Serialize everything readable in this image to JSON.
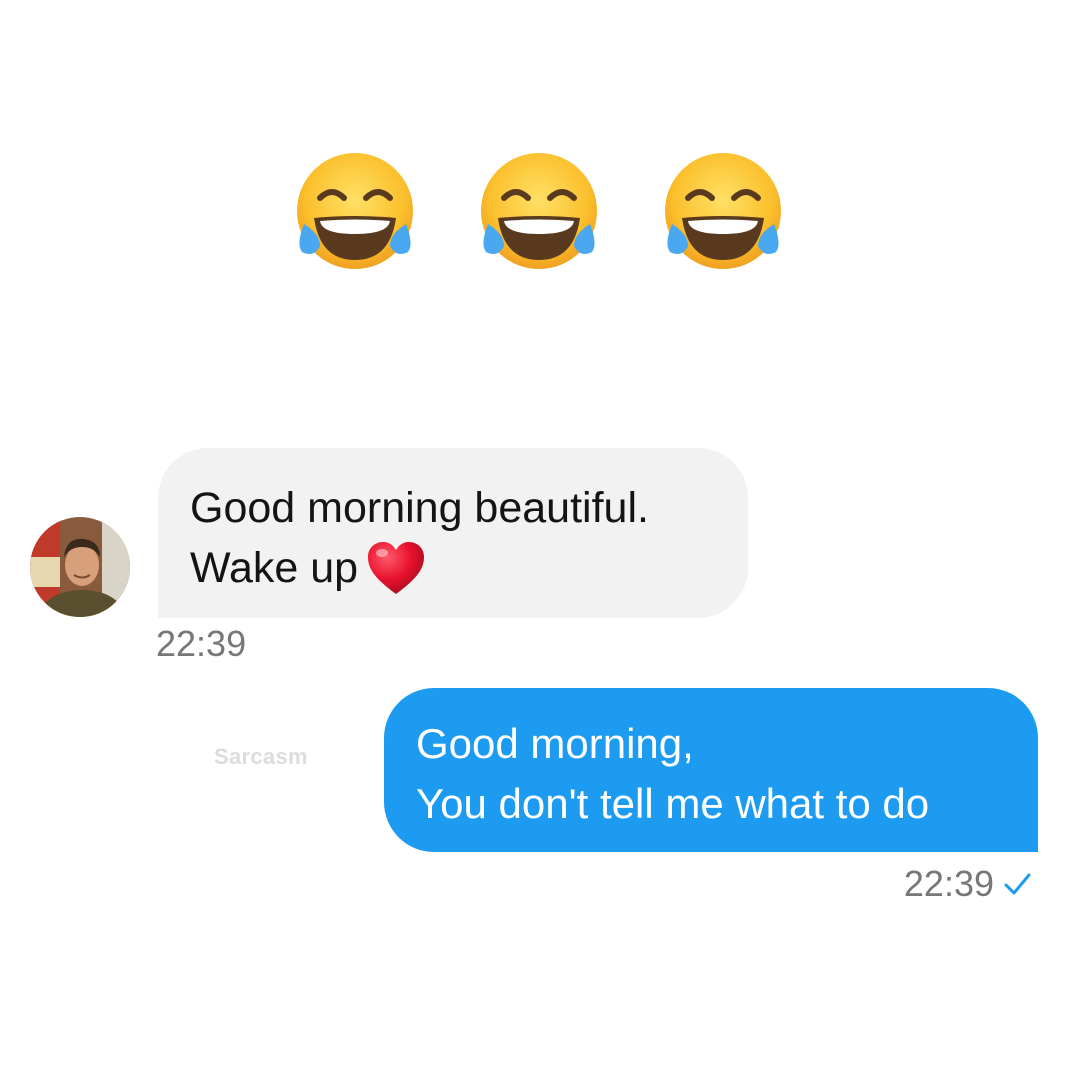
{
  "emoji_row": {
    "icons": [
      "face-with-tears-of-joy",
      "face-with-tears-of-joy",
      "face-with-tears-of-joy"
    ]
  },
  "conversation": {
    "incoming": {
      "lines": [
        "Good morning beautiful.",
        "Wake up"
      ],
      "trailing_icon": "red-heart",
      "time": "22:39",
      "bubble_color": "#f2f2f2",
      "avatar": "contact-photo"
    },
    "outgoing": {
      "lines": [
        "Good morning,",
        "You don't tell me what to do"
      ],
      "time": "22:39",
      "status_icon": "checkmark",
      "bubble_color": "#1d9bf0"
    }
  },
  "watermark": "Sarcasm",
  "colors": {
    "accent": "#1d9bf0",
    "timestamp": "#777777",
    "heart": "#e8112d"
  }
}
